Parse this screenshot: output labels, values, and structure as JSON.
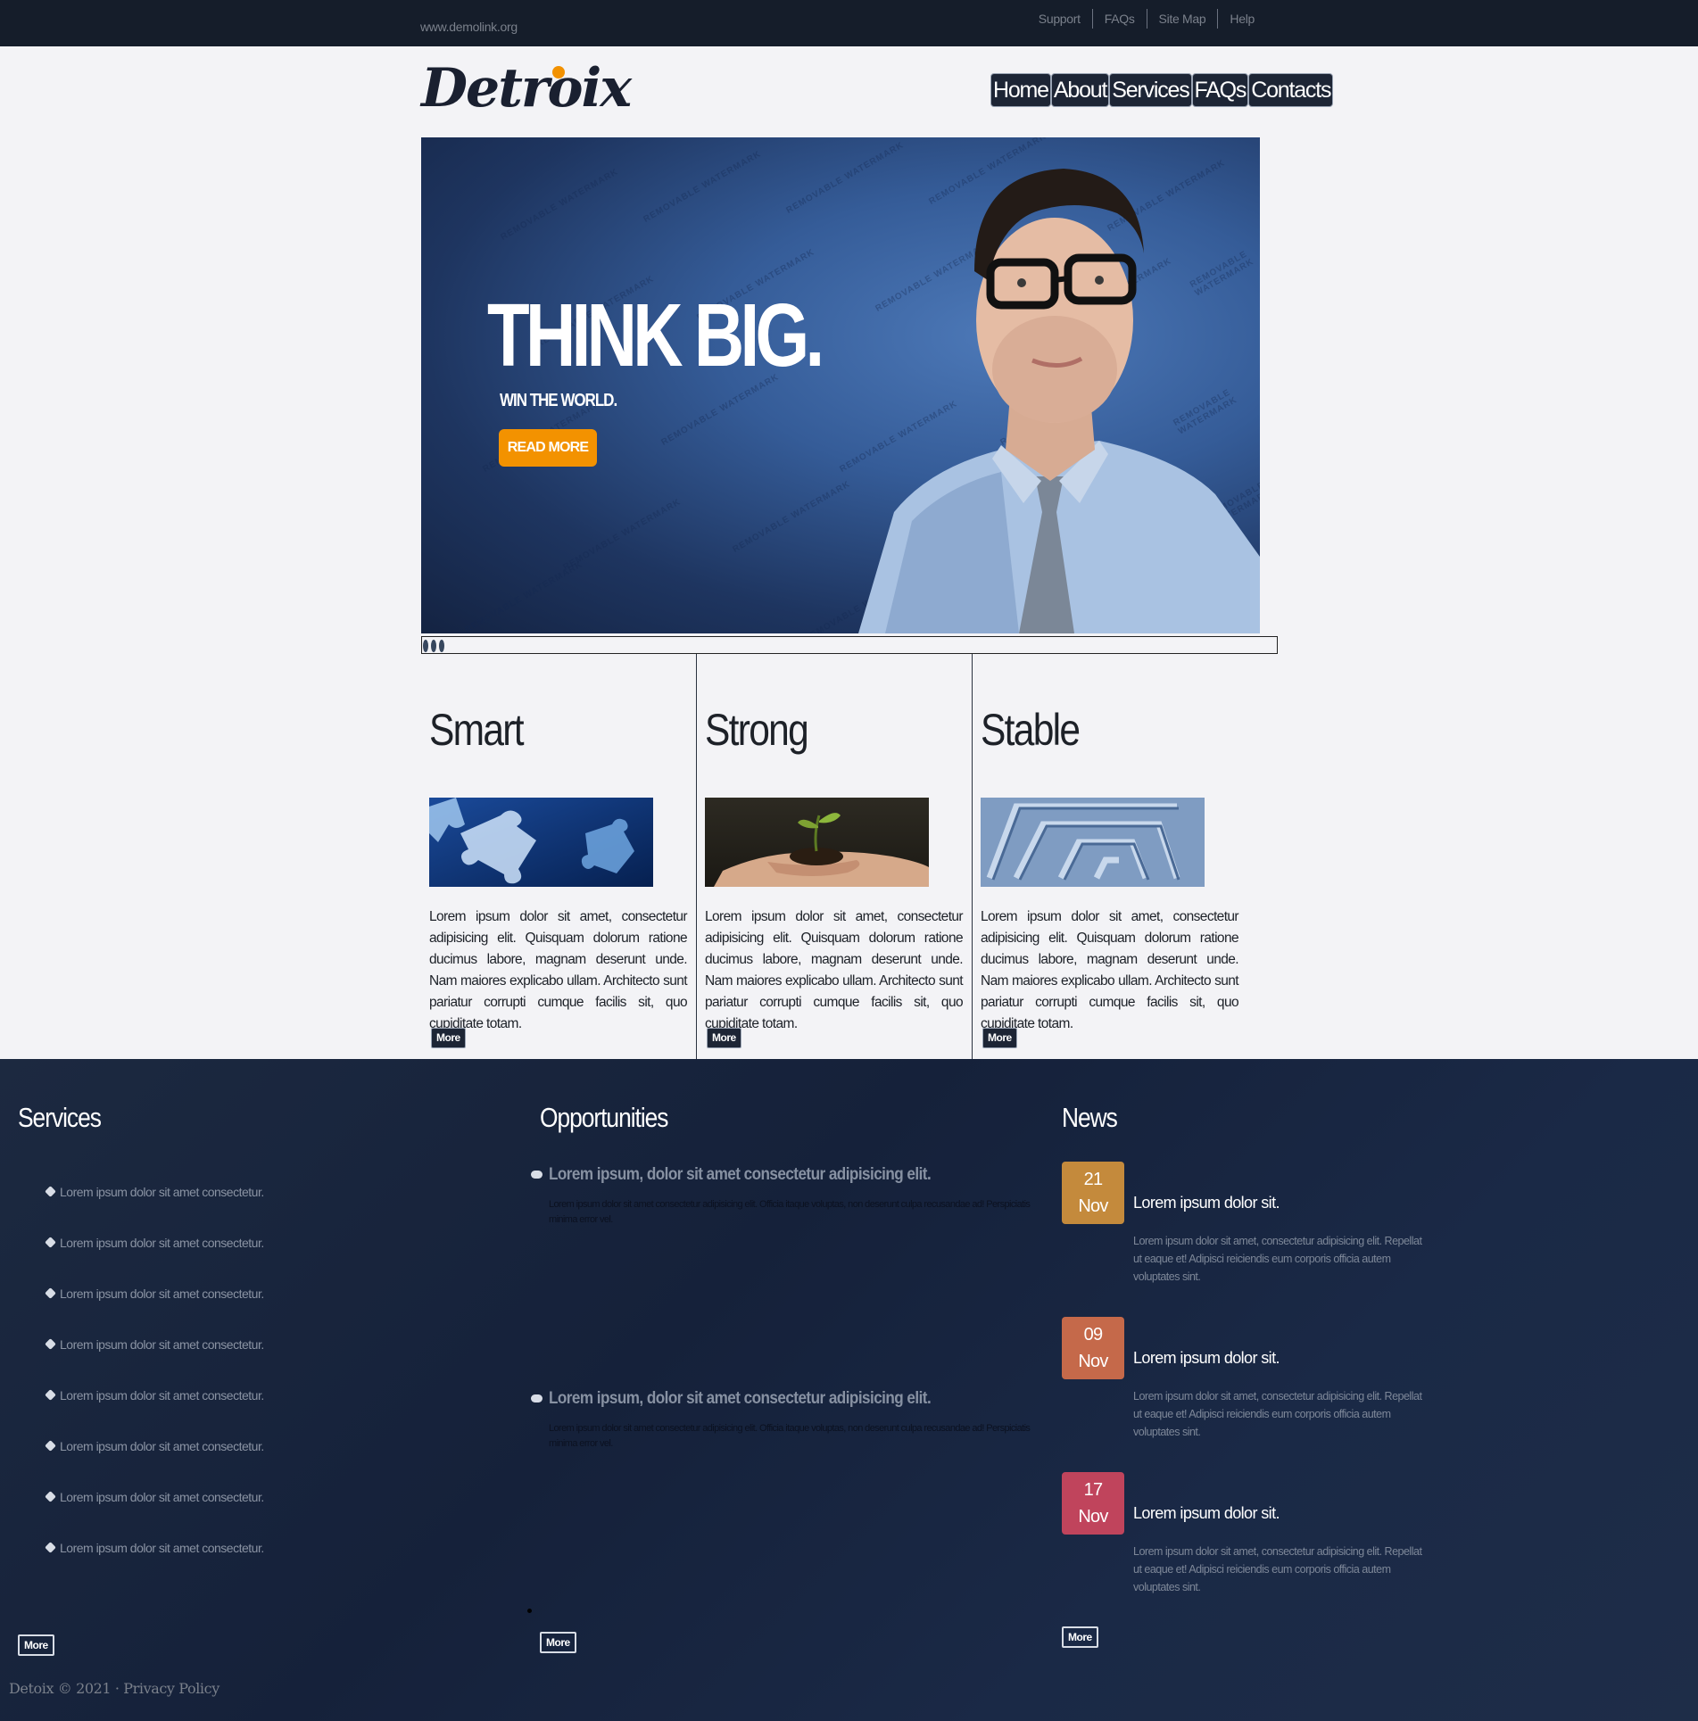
{
  "topbar": {
    "site": "www.demolink.org",
    "links": [
      "Support",
      "FAQs",
      "Site Map",
      "Help"
    ]
  },
  "header": {
    "logo": "Detroix",
    "nav": [
      "Home",
      "About",
      "Services",
      "FAQs",
      "Contacts"
    ]
  },
  "hero": {
    "title": "THINK BIG.",
    "subtitle": "WIN THE WORLD.",
    "button": "READ MORE",
    "watermark": "REMOVABLE WATERMARK"
  },
  "features": [
    {
      "title": "Smart",
      "text": "Lorem ipsum dolor sit amet, consectetur adipisicing elit. Quisquam dolorum ratione ducimus labore, magnam deserunt unde. Nam maiores explicabo ullam. Architecto sunt pariatur corrupti cumque facilis sit, quo cupiditate totam.",
      "more": "More"
    },
    {
      "title": "Strong",
      "text": "Lorem ipsum dolor sit amet, consectetur adipisicing elit. Quisquam dolorum ratione ducimus labore, magnam deserunt unde. Nam maiores explicabo ullam. Architecto sunt pariatur corrupti cumque facilis sit, quo cupiditate totam.",
      "more": "More"
    },
    {
      "title": "Stable",
      "text": "Lorem ipsum dolor sit amet, consectetur adipisicing elit. Quisquam dolorum ratione ducimus labore, magnam deserunt unde. Nam maiores explicabo ullam. Architecto sunt pariatur corrupti cumque facilis sit, quo cupiditate totam.",
      "more": "More"
    }
  ],
  "services": {
    "title": "Services",
    "items": [
      "Lorem ipsum dolor sit amet consectetur.",
      "Lorem ipsum dolor sit amet consectetur.",
      "Lorem ipsum dolor sit amet consectetur.",
      "Lorem ipsum dolor sit amet consectetur.",
      "Lorem ipsum dolor sit amet consectetur.",
      "Lorem ipsum dolor sit amet consectetur.",
      "Lorem ipsum dolor sit amet consectetur.",
      "Lorem ipsum dolor sit amet consectetur."
    ],
    "more": "More"
  },
  "opportunities": {
    "title": "Opportunities",
    "items": [
      {
        "heading": "Lorem ipsum, dolor sit amet consectetur adipisicing elit.",
        "text": "Lorem ipsum dolor sit amet consectetur adipisicing elit. Officia itaque voluptas, non deserunt culpa recusandae ad! Perspiciatis minima error vel."
      },
      {
        "heading": "Lorem ipsum, dolor sit amet consectetur adipisicing elit.",
        "text": "Lorem ipsum dolor sit amet consectetur adipisicing elit. Officia itaque voluptas, non deserunt culpa recusandae ad! Perspiciatis minima error vel."
      }
    ],
    "more": "More"
  },
  "news": {
    "title": "News",
    "items": [
      {
        "day": "21",
        "month": "Nov",
        "color": "#c48a3c",
        "heading": "Lorem ipsum dolor sit.",
        "text": "Lorem ipsum dolor sit amet, consectetur adipisicing elit. Repellat ut eaque et! Adipisci reiciendis eum corporis officia autem voluptates sint."
      },
      {
        "day": "09",
        "month": "Nov",
        "color": "#c5694a",
        "heading": "Lorem ipsum dolor sit.",
        "text": "Lorem ipsum dolor sit amet, consectetur adipisicing elit. Repellat ut eaque et! Adipisci reiciendis eum corporis officia autem voluptates sint."
      },
      {
        "day": "17",
        "month": "Nov",
        "color": "#c0445c",
        "heading": "Lorem ipsum dolor sit.",
        "text": "Lorem ipsum dolor sit amet, consectetur adipisicing elit. Repellat ut eaque et! Adipisci reiciendis eum corporis officia autem voluptates sint."
      }
    ],
    "more": "More"
  },
  "copyright": "Detoix © 2021 · Privacy Policy"
}
